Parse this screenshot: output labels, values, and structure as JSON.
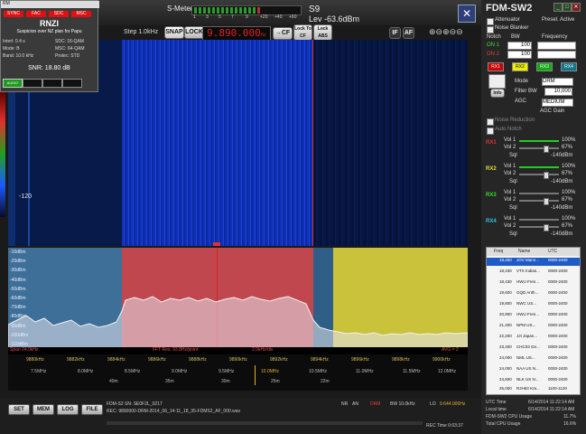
{
  "popup": {
    "title": "RM",
    "flags": [
      "SYNC",
      "FAC",
      "SDC",
      "MSC"
    ],
    "station": "RNZI",
    "program": "Suspicion over NZ plan for Papu",
    "interl": "Interl: 0.4 s",
    "sdc": "SDC: 16-QAM",
    "mode": "Mode: B",
    "msc": "MSC: 64-QAM",
    "band": "Band: 10.0 kHz",
    "protec": "Protec: STD",
    "snr": "SNR: 18.80 dB",
    "audio": "AUDIO"
  },
  "meter": {
    "label": "S-Meter",
    "scale": [
      "1",
      "3",
      "5",
      "7",
      "9",
      "+20",
      "+40",
      "+60"
    ],
    "s": "S9",
    "level": "Lev -63.6dBm"
  },
  "controls": {
    "step": "Step 1.0kHz",
    "snap": "SNAP",
    "lock": "LOCK",
    "freq": "9.890.000",
    "freq_unit": "Hz",
    "tocf": "→CF",
    "lock_to_cf": "Lock To CF",
    "lock_abs": "Lock ABS",
    "if": "IF",
    "af": "AF"
  },
  "waterfall": {
    "minus120": "-120"
  },
  "spectrum": {
    "db_labels": [
      "-10dBm",
      "-20dBm",
      "-30dBm",
      "-40dBm",
      "-50dBm",
      "-60dBm",
      "-70dBm",
      "-80dBm",
      "-90dBm",
      "-100dBm",
      "-110dBm",
      "-120dBm"
    ],
    "span": "Span 24.0kHz",
    "fft": "FFT Res. 93.8Hz/point",
    "div": "2.0kHz/div",
    "avg": "AVG = 2"
  },
  "scale": {
    "khz_ticks": [
      "9880kHz",
      "9882kHz",
      "9884kHz",
      "9886kHz",
      "9888kHz",
      "9890kHz",
      "9892kHz",
      "9894kHz",
      "9896kHz",
      "9898kHz",
      "9900kHz"
    ],
    "mhz_ticks": [
      "7.5MHz",
      "8.0MHz",
      "8.5MHz",
      "9.0MHz",
      "9.5MHz",
      "10.0MHz",
      "10.5MHz",
      "11.0MHz",
      "11.5MHz",
      "12.0MHz"
    ],
    "m_ticks": [
      "40m",
      "35m",
      "30m",
      "25m",
      "22m"
    ]
  },
  "bottom": {
    "buttons": [
      "SET",
      "MEM",
      "LOG",
      "FILE"
    ],
    "sn": "FDM-S2 SN: SE0F2L_0217",
    "rec": "REC: 9890000-DRM-2014_06_14-11_18_35-FDMS2_AF_000.wav",
    "nr": "NR",
    "an": "AN",
    "drm": "DRM",
    "bw": "BW 10.0kHz",
    "lo": "LO",
    "lo_val": "9.644.000Hz",
    "rec_time": "REC Time 0:03:37"
  },
  "panel": {
    "title": "FDM-SW2",
    "attenuator": "Attenuator",
    "preselector": "Presel. Active",
    "noise_blanker": "Noise Blanker",
    "notch": "Notch",
    "bw": "BW",
    "frequency": "Frequency",
    "on1": "ON 1",
    "on2": "ON 2",
    "bw1": "100",
    "bw2": "100",
    "rx_tabs": [
      "RX1",
      "RX2",
      "RX3",
      "RX4"
    ],
    "mode_label": "Mode",
    "mode_val": "DRM",
    "filter_label": "Filter BW",
    "filter_val": "10,000",
    "agc_label": "AGC",
    "agc_val": "MEDIUM",
    "agc_gain": "AGC Gain",
    "info": "Info",
    "noise_reduction": "Noise Reduction",
    "auto_notch": "Auto Notch",
    "rx_blocks": [
      {
        "name": "RX1",
        "vol1": "Vol 1",
        "v1": "100%",
        "vol2": "Vol 2",
        "v2": "67%",
        "sql": "Sql",
        "s": "-140dBm"
      },
      {
        "name": "RX2",
        "vol1": "Vol 1",
        "v1": "100%",
        "vol2": "Vol 2",
        "v2": "67%",
        "sql": "Sql",
        "s": "-140dBm"
      },
      {
        "name": "RX3",
        "vol1": "Vol 1",
        "v1": "100%",
        "vol2": "Vol 2",
        "v2": "67%",
        "sql": "Sql",
        "s": "-140dBm"
      },
      {
        "name": "RX4",
        "vol1": "Vol 1",
        "v1": "100%",
        "vol2": "Vol 2",
        "v2": "67%",
        "sql": "Sql",
        "s": "-140dBm"
      }
    ]
  },
  "flist": {
    "headers": [
      "Freq",
      "Name",
      "UTC"
    ],
    "rows": [
      [
        "18,400",
        "JOV Mann...",
        "0000-2400"
      ],
      [
        "18,430",
        "VTX Indian...",
        "0000-2400"
      ],
      [
        "18,430",
        "HWU Fren...",
        "0000-2400"
      ],
      [
        "19,600",
        "GQD Anth...",
        "0000-2400"
      ],
      [
        "19,800",
        "NWC US...",
        "0000-2400"
      ],
      [
        "20,900",
        "HWU Fren...",
        "0000-2400"
      ],
      [
        "21,400",
        "NPM US...",
        "0000-2400"
      ],
      [
        "22,200",
        "JJI Japan...",
        "0000-2400"
      ],
      [
        "23,400",
        "CHC03 Ge...",
        "0000-2400"
      ],
      [
        "24,000",
        "NML US...",
        "0000-2400"
      ],
      [
        "24,000",
        "NAA US N...",
        "0000-2400"
      ],
      [
        "24,600",
        "NLK US N...",
        "0000-2400"
      ],
      [
        "25,000",
        "RJH63 Kra...",
        "1100-1120"
      ]
    ]
  },
  "status": {
    "utc_label": "UTC Time",
    "utc": "6/14/2014 11:22:14 AM",
    "local_label": "Local time",
    "local": "6/14/2014 11:22:14 AM",
    "cpu_label": "FDM-SW2 CPU Usage",
    "cpu": "11.7%",
    "total_label": "Total CPU Usage",
    "total": "16.6%"
  }
}
